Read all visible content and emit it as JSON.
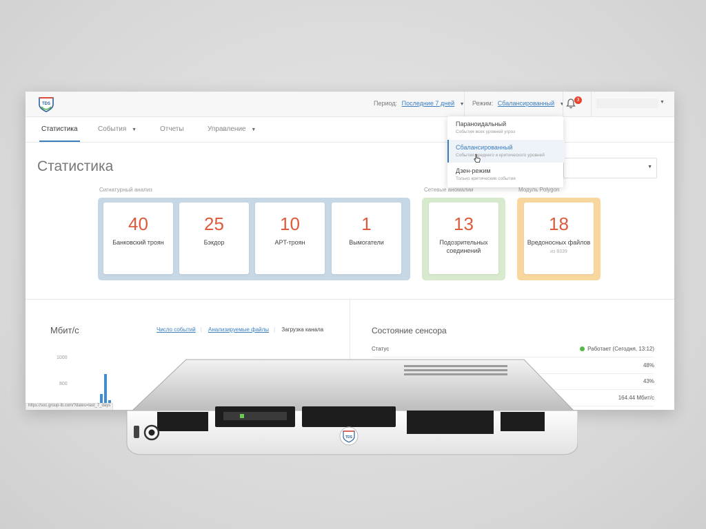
{
  "topbar": {
    "period_label": "Период:",
    "period_value": "Последние 7 дней",
    "mode_label": "Режим:",
    "mode_value": "Сбалансированный",
    "notification_count": "3",
    "logo_text": "TDS"
  },
  "tabs": [
    {
      "label": "Статистика",
      "active": true
    },
    {
      "label": "События",
      "dropdown": true
    },
    {
      "label": "Отчеты"
    },
    {
      "label": "Управление",
      "dropdown": true
    }
  ],
  "page_title": "Статистика",
  "mode_menu": [
    {
      "title": "Параноидальный",
      "desc": "События всех уровней угроз"
    },
    {
      "title": "Сбалансированный",
      "desc": "События среднего и критического уровней",
      "selected": true
    },
    {
      "title": "Дзен-режим",
      "desc": "Только критические события"
    }
  ],
  "signature": {
    "label": "Сигнатурный анализ",
    "cards": [
      {
        "value": "40",
        "label": "Банковский троян"
      },
      {
        "value": "25",
        "label": "Бэкдор"
      },
      {
        "value": "10",
        "label": "APT-троян"
      },
      {
        "value": "1",
        "label": "Вымогатели"
      }
    ]
  },
  "network": {
    "label": "Сетевые аномалии",
    "card": {
      "value": "13",
      "label_line1": "Подозрительных",
      "label_line2": "соединений"
    }
  },
  "polygon": {
    "label": "Модуль Polygon",
    "card": {
      "value": "18",
      "label": "Вредоносных файлов",
      "sub": "из 8339"
    }
  },
  "traffic": {
    "title": "Мбит/с",
    "tabs": [
      "Число событий",
      "Анализируемые файлы",
      "Загрузка канала"
    ],
    "active_tab": "Загрузка канала",
    "y_ticks": [
      "1000",
      "800"
    ]
  },
  "chart_data": {
    "type": "bar",
    "ylabel": "Мбит/с",
    "y_ticks": [
      800,
      1000
    ],
    "values": [
      120,
      850,
      40
    ]
  },
  "sensor": {
    "title": "Состояние сенсора",
    "rows": [
      {
        "key": "Статус",
        "value": "Работает (Сегодня, 13:12)",
        "status": true
      },
      {
        "key": "",
        "value": "48%"
      },
      {
        "key": "",
        "value": "43%"
      },
      {
        "key": "",
        "value": "164.44 Мбит/с"
      }
    ]
  },
  "status_url": "https://soc.group-ib.com/?dates=last_7_days",
  "colors": {
    "accent": "#3a7ebf",
    "number": "#dd5a3c",
    "group_blue": "#c6d7e6",
    "group_green": "#d7eacd",
    "group_orange": "#f8d79e",
    "status_ok": "#56b84a",
    "badge": "#e8452f"
  },
  "server": {
    "logo_text": "TDS"
  }
}
